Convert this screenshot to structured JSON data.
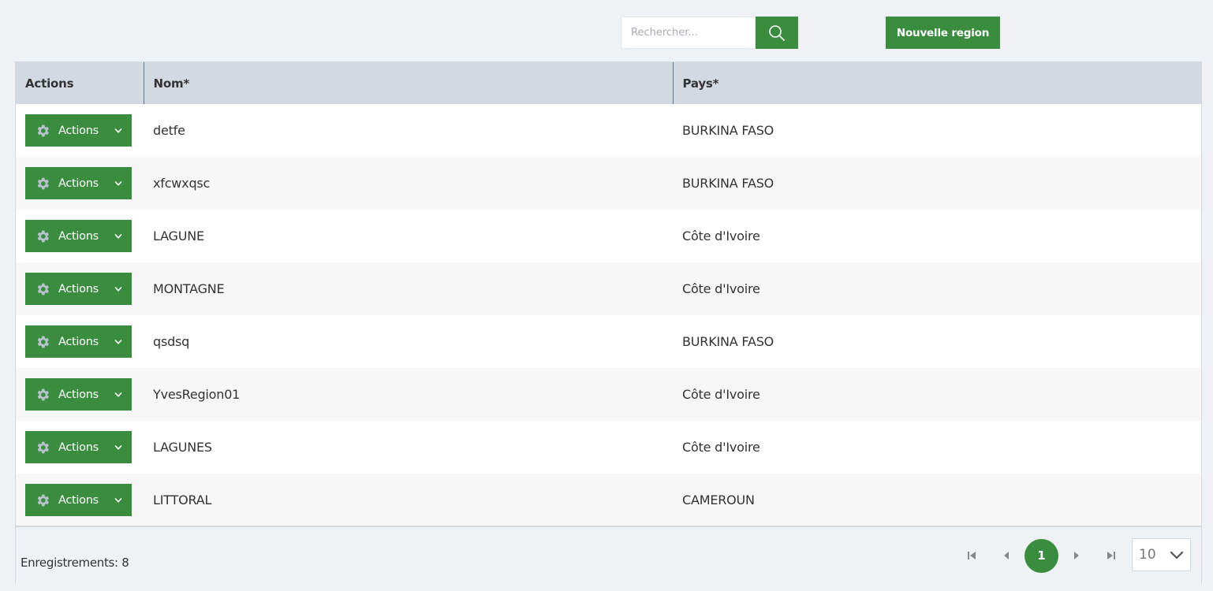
{
  "search": {
    "placeholder": "Rechercher...",
    "icon": "search-icon"
  },
  "toolbar": {
    "new_label": "Nouvelle region"
  },
  "table": {
    "headers": {
      "actions": "Actions",
      "nom": "Nom*",
      "pays": "Pays*"
    },
    "action_label": "Actions",
    "rows": [
      {
        "nom": "detfe",
        "pays": "BURKINA FASO"
      },
      {
        "nom": "xfcwxqsc",
        "pays": "BURKINA FASO"
      },
      {
        "nom": "LAGUNE",
        "pays": "Côte d'Ivoire"
      },
      {
        "nom": "MONTAGNE",
        "pays": "Côte d'Ivoire"
      },
      {
        "nom": "qsdsq",
        "pays": "BURKINA FASO"
      },
      {
        "nom": "YvesRegion01",
        "pays": "Côte d'Ivoire"
      },
      {
        "nom": "LAGUNES",
        "pays": "Côte d'Ivoire"
      },
      {
        "nom": "LITTORAL",
        "pays": "CAMEROUN"
      }
    ]
  },
  "footer": {
    "count_text": "Enregistrements: 8",
    "current_page": "1",
    "per_page": "10"
  },
  "colors": {
    "accent": "#3a8c3f",
    "header_bg": "#d2d9e0",
    "page_bg": "#eff2f5"
  }
}
